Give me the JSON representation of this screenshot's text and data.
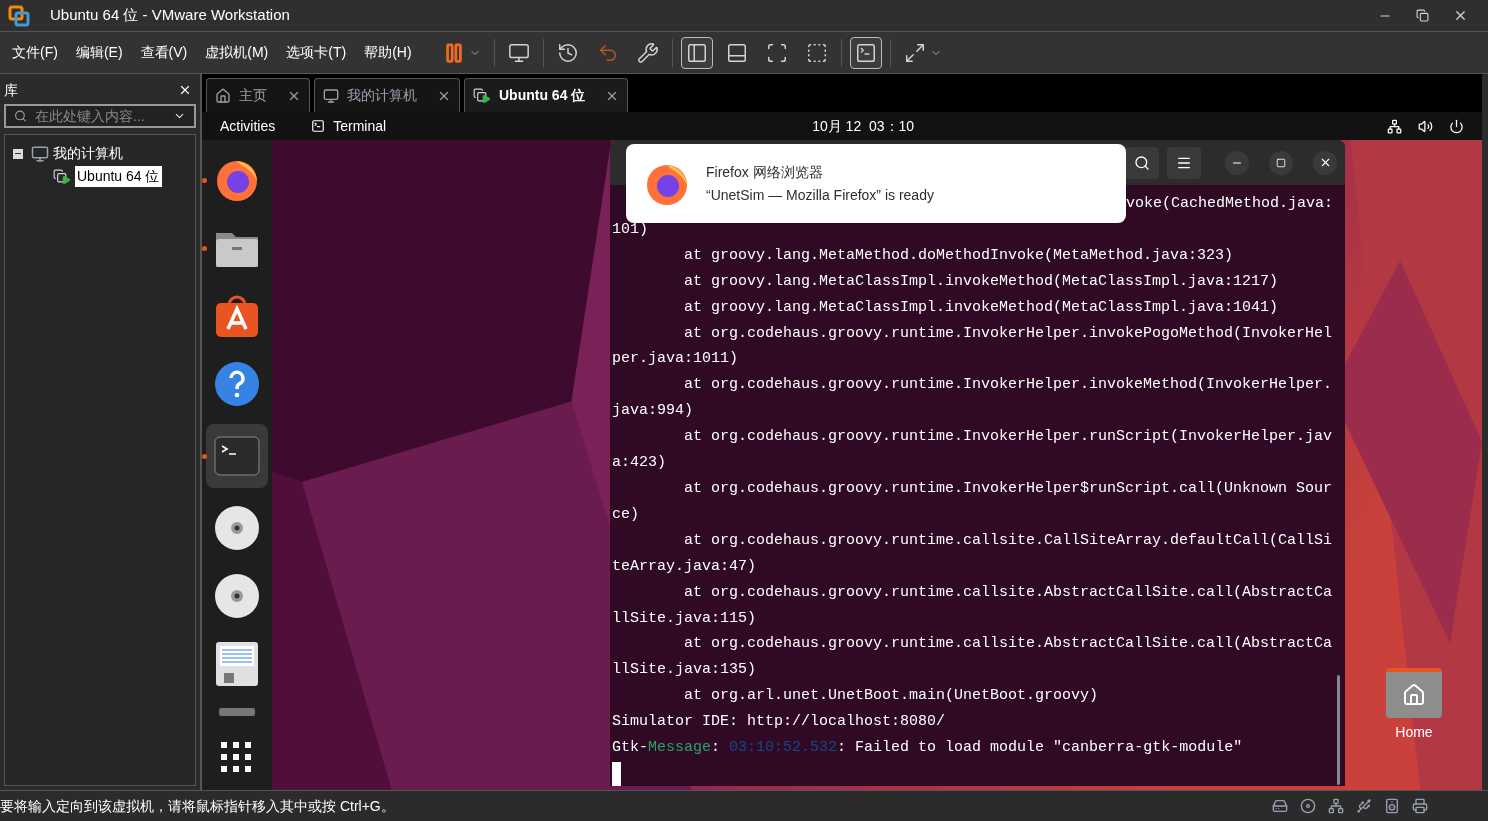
{
  "window": {
    "title": "Ubuntu 64 位 - VMware Workstation"
  },
  "menu": [
    "文件(F)",
    "编辑(E)",
    "查看(V)",
    "虚拟机(M)",
    "选项卡(T)",
    "帮助(H)"
  ],
  "toolbar": [
    {
      "kind": "pause",
      "selected": false
    },
    {
      "kind": "send-keys",
      "selected": false
    },
    {
      "kind": "snapshot",
      "selected": false
    },
    {
      "kind": "revert",
      "selected": false
    },
    {
      "kind": "snapshot-manager",
      "selected": false
    },
    {
      "kind": "library-view",
      "selected": true
    },
    {
      "kind": "thumbnail-view",
      "selected": false
    },
    {
      "kind": "fit-view",
      "selected": false
    },
    {
      "kind": "unity-view",
      "selected": false
    },
    {
      "kind": "console-view",
      "selected": true
    },
    {
      "kind": "fullscreen",
      "selected": false
    }
  ],
  "library": {
    "title": "库",
    "search": {
      "placeholder": "在此处键入内容..."
    },
    "tree": [
      {
        "label": "我的计算机",
        "expanded": true,
        "children": [
          {
            "label": "Ubuntu 64 位",
            "selected": true
          }
        ]
      }
    ]
  },
  "tabs": [
    {
      "label": "主页",
      "kind": "home",
      "selected": false
    },
    {
      "label": "我的计算机",
      "kind": "computer",
      "selected": false
    },
    {
      "label": "Ubuntu 64 位",
      "kind": "vm",
      "selected": true
    }
  ],
  "ubuntu": {
    "activities": "Activities",
    "app": "Terminal",
    "clock": "10月 12  03：10",
    "dock": [
      {
        "kind": "firefox",
        "running": true,
        "selected": false
      },
      {
        "kind": "files",
        "running": true,
        "selected": false
      },
      {
        "kind": "appcenter",
        "running": false,
        "selected": false
      },
      {
        "kind": "help",
        "running": false,
        "selected": false
      },
      {
        "kind": "terminal",
        "running": true,
        "selected": true
      },
      {
        "kind": "disc",
        "running": false,
        "selected": false
      },
      {
        "kind": "disc",
        "running": false,
        "selected": false
      },
      {
        "kind": "editor",
        "running": false,
        "selected": false
      },
      {
        "kind": "drive",
        "running": false,
        "selected": false
      },
      {
        "kind": "grid",
        "running": false,
        "selected": false
      }
    ],
    "desktop_icon": {
      "label": "Home"
    },
    "notification": {
      "title": "Firefox 网络浏览器",
      "body": "“UnetSim — Mozilla Firefox” is ready"
    },
    "terminal": {
      "partial_line": "voke(CachedMethod.java:",
      "lines": [
        [
          {
            "text": "101)",
            "color": "#ffffff"
          }
        ],
        [
          {
            "text": "        at groovy.lang.MetaMethod.doMethodInvoke(MetaMethod.java:323)",
            "color": "#ffffff"
          }
        ],
        [
          {
            "text": "        at groovy.lang.MetaClassImpl.invokeMethod(MetaClassImpl.java:1217)",
            "color": "#ffffff"
          }
        ],
        [
          {
            "text": "        at groovy.lang.MetaClassImpl.invokeMethod(MetaClassImpl.java:1041)",
            "color": "#ffffff"
          }
        ],
        [
          {
            "text": "        at org.codehaus.groovy.runtime.InvokerHelper.invokePogoMethod(InvokerHel",
            "color": "#ffffff"
          }
        ],
        [
          {
            "text": "per.java:1011)",
            "color": "#ffffff"
          }
        ],
        [
          {
            "text": "        at org.codehaus.groovy.runtime.InvokerHelper.invokeMethod(InvokerHelper.",
            "color": "#ffffff"
          }
        ],
        [
          {
            "text": "java:994)",
            "color": "#ffffff"
          }
        ],
        [
          {
            "text": "        at org.codehaus.groovy.runtime.InvokerHelper.runScript(InvokerHelper.jav",
            "color": "#ffffff"
          }
        ],
        [
          {
            "text": "a:423)",
            "color": "#ffffff"
          }
        ],
        [
          {
            "text": "        at org.codehaus.groovy.runtime.InvokerHelper$runScript.call(Unknown Sour",
            "color": "#ffffff"
          }
        ],
        [
          {
            "text": "ce)",
            "color": "#ffffff"
          }
        ],
        [
          {
            "text": "        at org.codehaus.groovy.runtime.callsite.CallSiteArray.defaultCall(CallSi",
            "color": "#ffffff"
          }
        ],
        [
          {
            "text": "teArray.java:47)",
            "color": "#ffffff"
          }
        ],
        [
          {
            "text": "        at org.codehaus.groovy.runtime.callsite.AbstractCallSite.call(AbstractCa",
            "color": "#ffffff"
          }
        ],
        [
          {
            "text": "llSite.java:115)",
            "color": "#ffffff"
          }
        ],
        [
          {
            "text": "        at org.codehaus.groovy.runtime.callsite.AbstractCallSite.call(AbstractCa",
            "color": "#ffffff"
          }
        ],
        [
          {
            "text": "llSite.java:135)",
            "color": "#ffffff"
          }
        ],
        [
          {
            "text": "        at org.arl.unet.UnetBoot.main(UnetBoot.groovy)",
            "color": "#ffffff"
          }
        ],
        [
          {
            "text": "Simulator IDE: http://localhost:8080/",
            "color": "#ffffff"
          }
        ],
        [
          {
            "text": "Gtk-",
            "color": "#ffffff"
          },
          {
            "text": "Message",
            "color": "#26a269"
          },
          {
            "text": ": ",
            "color": "#ffffff"
          },
          {
            "text": "03:10:52.532",
            "color": "#12488b"
          },
          {
            "text": ": Failed to load module \"canberra-gtk-module\"",
            "color": "#ffffff"
          }
        ]
      ]
    }
  },
  "status_bar": "要将输入定向到该虚拟机，请将鼠标指针移入其中或按 Ctrl+G。"
}
